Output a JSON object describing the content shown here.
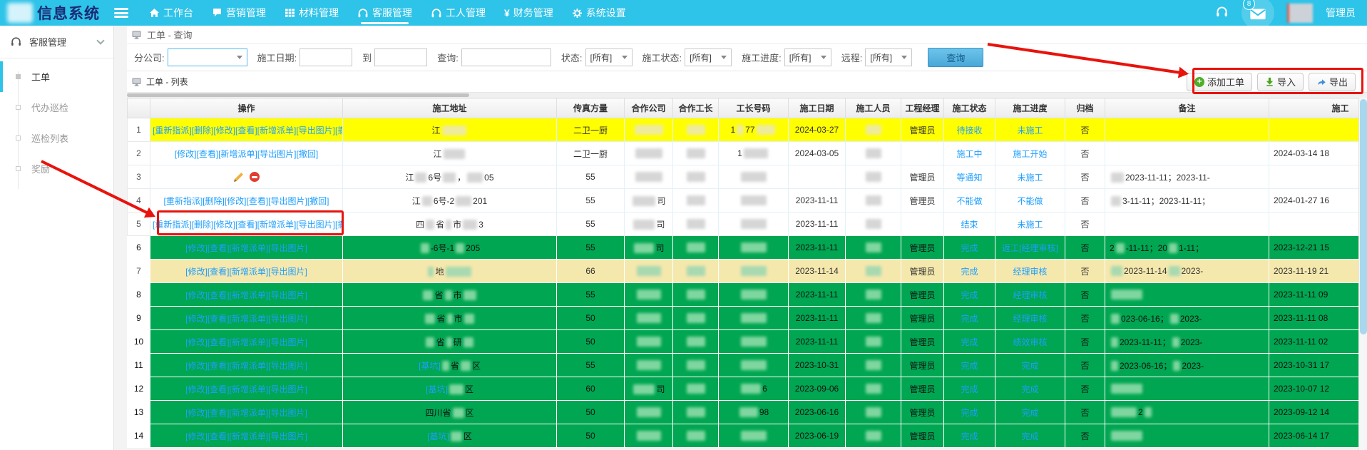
{
  "colors": {
    "accent": "#2ec3e8",
    "link": "#1e9fff",
    "row_green": "#00a651",
    "row_yellow": "#ffff00",
    "row_cream": "#f5e8ad",
    "annotation_red": "#e8130c"
  },
  "navbar": {
    "brand": "信息系统",
    "items": [
      {
        "label": "工作台",
        "icon": "home-icon",
        "active": false
      },
      {
        "label": "营销管理",
        "icon": "chat-icon",
        "active": false
      },
      {
        "label": "材料管理",
        "icon": "grid-icon",
        "active": false
      },
      {
        "label": "客服管理",
        "icon": "headset-icon",
        "active": true
      },
      {
        "label": "工人管理",
        "icon": "headset-icon",
        "active": false
      },
      {
        "label": "财务管理",
        "icon": "yen-icon",
        "active": false
      },
      {
        "label": "系统设置",
        "icon": "gear-icon",
        "active": false
      }
    ],
    "message_badge": "8",
    "username": "管理员"
  },
  "sidebar": {
    "section": "客服管理",
    "items": [
      {
        "label": "工单",
        "active": true
      },
      {
        "label": "代办巡检",
        "active": false
      },
      {
        "label": "巡检列表",
        "active": false
      },
      {
        "label": "奖励",
        "active": false
      }
    ]
  },
  "query_panel": {
    "title": "工单 - 查询",
    "branch_label": "分公司:",
    "date_label": "施工日期:",
    "to_label": "到",
    "keyword_label": "查询:",
    "status_label": "状态:",
    "work_status_label": "施工状态:",
    "progress_label": "施工进度:",
    "remote_label": "远程:",
    "all_option": "[所有]",
    "search_button": "查询"
  },
  "toolbar": {
    "add": "添加工单",
    "import": "导入",
    "export": "导出"
  },
  "list_panel": {
    "title": "工单 - 列表"
  },
  "table": {
    "headers": [
      "",
      "操作",
      "施工地址",
      "传真方量",
      "合作公司",
      "合作工长",
      "工长号码",
      "施工日期",
      "施工人员",
      "工程经理",
      "施工状态",
      "施工进度",
      "归档",
      "备注",
      "施工"
    ],
    "rows": [
      {
        "num": "1",
        "bg": "yellow",
        "ops": {
          "type": "links",
          "text": "[重新指派][删除][修改][查看][新增派单][导出图片][撤回]"
        },
        "addr": [
          {
            "t": "江"
          },
          {
            "b": 34
          }
        ],
        "volume": "二卫一厨",
        "partner": [
          {
            "b": 40
          }
        ],
        "foreman": [
          {
            "b": 26
          }
        ],
        "phone": [
          {
            "t": "1"
          },
          {
            "b": 10
          },
          {
            "t": "77"
          },
          {
            "b": 26
          }
        ],
        "date": "2024-03-27",
        "worker": [
          {
            "b": 22
          }
        ],
        "manager": "管理员",
        "status": "待接收",
        "progress": "未施工",
        "archived": "否",
        "remark": [],
        "time": ""
      },
      {
        "num": "2",
        "bg": "white",
        "ops": {
          "type": "links",
          "text": "[修改][查看][新增派单][导出图片][撤回]"
        },
        "addr": [
          {
            "t": "江"
          },
          {
            "b": 30
          }
        ],
        "volume": "二卫一厨",
        "partner": [
          {
            "b": 38
          }
        ],
        "foreman": [
          {
            "b": 26
          }
        ],
        "phone": [
          {
            "t": "1"
          },
          {
            "b": 34
          }
        ],
        "date": "2024-03-05",
        "worker": [
          {
            "b": 22
          }
        ],
        "manager": "",
        "status": "施工中",
        "progress": "施工开始",
        "archived": "否",
        "remark": [],
        "time": "2024-03-14 18"
      },
      {
        "num": "3",
        "bg": "white",
        "ops": {
          "type": "icons"
        },
        "addr": [
          {
            "t": "江"
          },
          {
            "b": 16
          },
          {
            "t": "6号"
          },
          {
            "b": 18
          },
          {
            "t": "，"
          },
          {
            "b": 22
          },
          {
            "t": "05"
          }
        ],
        "volume": "55",
        "partner": [
          {
            "b": 38
          }
        ],
        "foreman": [
          {
            "b": 26
          }
        ],
        "phone": [
          {
            "b": 36
          }
        ],
        "date": "",
        "worker": [
          {
            "b": 22
          }
        ],
        "manager": "管理员",
        "status": "等通知",
        "progress": "未施工",
        "archived": "否",
        "remark": [
          {
            "b": 18
          },
          {
            "t": "2023-11-11；2023-11-"
          }
        ],
        "time": ""
      },
      {
        "num": "4",
        "bg": "white",
        "ops": {
          "type": "links",
          "text": "[重新指派][删除][修改][查看][导出图片][撤回]"
        },
        "addr": [
          {
            "t": "江"
          },
          {
            "b": 14
          },
          {
            "t": "6号-2"
          },
          {
            "b": 22
          },
          {
            "t": "201"
          }
        ],
        "volume": "55",
        "partner": [
          {
            "b": 32
          },
          {
            "t": "司"
          }
        ],
        "foreman": [
          {
            "b": 26
          }
        ],
        "phone": [
          {
            "b": 36
          }
        ],
        "date": "2023-11-11",
        "worker": [
          {
            "b": 22
          }
        ],
        "manager": "管理员",
        "status": "不能做",
        "progress": "不能做",
        "archived": "否",
        "remark": [
          {
            "b": 14
          },
          {
            "t": "3-11-11；2023-11-11；"
          }
        ],
        "time": "2024-01-27 16"
      },
      {
        "num": "5",
        "bg": "white",
        "boxed": true,
        "ops": {
          "type": "links",
          "text": "[重新指派][删除][修改][查看][新增派单][导出图片][撤回]"
        },
        "addr": [
          {
            "t": "四"
          },
          {
            "b": 12
          },
          {
            "t": "省"
          },
          {
            "b": 8
          },
          {
            "t": "市"
          },
          {
            "b": 20
          },
          {
            "t": "3"
          }
        ],
        "volume": "55",
        "partner": [
          {
            "b": 30
          },
          {
            "t": "司"
          }
        ],
        "foreman": [
          {
            "b": 26
          }
        ],
        "phone": [
          {
            "b": 36
          }
        ],
        "date": "2023-11-11",
        "worker": [
          {
            "b": 22
          }
        ],
        "manager": "",
        "status": "结束",
        "progress": "未施工",
        "archived": "否",
        "remark": [],
        "time": ""
      },
      {
        "num": "6",
        "bg": "green",
        "ops": {
          "type": "links",
          "text": "[修改][查看][新增派单][导出图片]"
        },
        "addr": [
          {
            "b": 12
          },
          {
            "t": "-6号-1"
          },
          {
            "b": 12
          },
          {
            "t": "205"
          }
        ],
        "volume": "55",
        "partner": [
          {
            "b": 28
          },
          {
            "t": "司"
          }
        ],
        "foreman": [
          {
            "b": 26
          }
        ],
        "phone": [
          {
            "b": 36
          }
        ],
        "date": "2023-11-11",
        "worker": [
          {
            "b": 22
          }
        ],
        "manager": "管理员",
        "status": "完成",
        "progress": "返工[经理审核]",
        "archived": "否",
        "remark": [
          {
            "t": "2"
          },
          {
            "b": 12
          },
          {
            "t": "-11-11；20"
          },
          {
            "b": 12
          },
          {
            "t": "1-11；"
          }
        ],
        "time": "2023-12-21 15"
      },
      {
        "num": "7",
        "bg": "cream",
        "ops": {
          "type": "links",
          "text": "[修改][查看][新增派单][导出图片]"
        },
        "addr": [
          {
            "b": 8
          },
          {
            "t": "地"
          },
          {
            "b": 36
          }
        ],
        "volume": "66",
        "partner": [
          {
            "b": 34
          }
        ],
        "foreman": [
          {
            "b": 26
          }
        ],
        "phone": [
          {
            "b": 36
          }
        ],
        "date": "2023-11-14",
        "worker": [
          {
            "b": 22
          }
        ],
        "manager": "管理员",
        "status": "完成",
        "progress": "经理审核",
        "archived": "否",
        "remark": [
          {
            "b": 16
          },
          {
            "t": "2023-11-14"
          },
          {
            "b": 16
          },
          {
            "t": "2023-"
          }
        ],
        "time": "2023-11-19 21"
      },
      {
        "num": "8",
        "bg": "green",
        "ops": {
          "type": "links",
          "text": "[修改][查看][新增派单][导出图片]"
        },
        "addr": [
          {
            "b": 14
          },
          {
            "t": "省"
          },
          {
            "b": 10
          },
          {
            "t": "市"
          },
          {
            "b": 18
          }
        ],
        "volume": "55",
        "partner": [
          {
            "b": 34
          }
        ],
        "foreman": [
          {
            "b": 26
          }
        ],
        "phone": [
          {
            "b": 36
          }
        ],
        "date": "2023-11-11",
        "worker": [
          {
            "b": 22
          }
        ],
        "manager": "管理员",
        "status": "完成",
        "progress": "经理审核",
        "archived": "否",
        "remark": [
          {
            "b": 44
          }
        ],
        "time": "2023-11-11 09"
      },
      {
        "num": "9",
        "bg": "green",
        "ops": {
          "type": "links",
          "text": "[修改][查看][新增派单][导出图片]"
        },
        "addr": [
          {
            "b": 14
          },
          {
            "t": "省"
          },
          {
            "b": 8
          },
          {
            "t": "市"
          },
          {
            "b": 14
          }
        ],
        "volume": "50",
        "partner": [
          {
            "b": 34
          }
        ],
        "foreman": [
          {
            "b": 26
          }
        ],
        "phone": [
          {
            "b": 36
          }
        ],
        "date": "2023-11-11",
        "worker": [
          {
            "b": 22
          }
        ],
        "manager": "管理员",
        "status": "完成",
        "progress": "经理审核",
        "archived": "否",
        "remark": [
          {
            "b": 12
          },
          {
            "t": "023-06-16；"
          },
          {
            "b": 12
          },
          {
            "t": "2023-"
          }
        ],
        "time": "2023-11-11 08"
      },
      {
        "num": "10",
        "bg": "green",
        "ops": {
          "type": "links",
          "text": "[修改][查看][新增派单][导出图片]"
        },
        "addr": [
          {
            "b": 12
          },
          {
            "t": "省"
          },
          {
            "b": 8
          },
          {
            "t": "研"
          },
          {
            "b": 14
          }
        ],
        "volume": "50",
        "partner": [
          {
            "b": 34
          }
        ],
        "foreman": [
          {
            "b": 26
          }
        ],
        "phone": [
          {
            "b": 36
          }
        ],
        "date": "2023-11-11",
        "worker": [
          {
            "b": 22
          }
        ],
        "manager": "管理员",
        "status": "完成",
        "progress": "绩效审核",
        "archived": "否",
        "remark": [
          {
            "b": 10
          },
          {
            "t": "2023-11-11；"
          },
          {
            "b": 10
          },
          {
            "t": "2023-"
          }
        ],
        "time": "2023-11-11 02"
      },
      {
        "num": "11",
        "bg": "green",
        "ops": {
          "type": "links",
          "text": "[修改][查看][新增派单][导出图片]"
        },
        "addr": [
          {
            "t": "[基坑]",
            "link": true
          },
          {
            "b": 10
          },
          {
            "t": "省"
          },
          {
            "b": 14
          },
          {
            "t": "区"
          }
        ],
        "volume": "55",
        "partner": [
          {
            "b": 34
          }
        ],
        "foreman": [
          {
            "b": 26
          }
        ],
        "phone": [
          {
            "b": 36
          }
        ],
        "date": "2023-10-31",
        "worker": [
          {
            "b": 22
          }
        ],
        "manager": "管理员",
        "status": "完成",
        "progress": "完成",
        "archived": "否",
        "remark": [
          {
            "b": 10
          },
          {
            "t": "2023-06-16；"
          },
          {
            "b": 10
          },
          {
            "t": "2023-"
          }
        ],
        "time": "2023-10-31 17"
      },
      {
        "num": "12",
        "bg": "green",
        "ops": {
          "type": "links",
          "text": "[修改][查看][新增派单][导出图片]"
        },
        "addr": [
          {
            "t": "[基坑]",
            "link": true
          },
          {
            "b": 20
          },
          {
            "t": "区"
          }
        ],
        "volume": "60",
        "partner": [
          {
            "b": 30
          },
          {
            "t": "司"
          }
        ],
        "foreman": [
          {
            "b": 26
          }
        ],
        "phone": [
          {
            "b": 28
          },
          {
            "t": "6"
          }
        ],
        "date": "2023-09-06",
        "worker": [
          {
            "b": 22
          }
        ],
        "manager": "管理员",
        "status": "完成",
        "progress": "完成",
        "archived": "否",
        "remark": [
          {
            "b": 44
          }
        ],
        "time": "2023-10-07 12"
      },
      {
        "num": "13",
        "bg": "green",
        "ops": {
          "type": "links",
          "text": "[修改][查看][新增派单][导出图片]"
        },
        "addr": [
          {
            "t": "四川省"
          },
          {
            "b": 16
          },
          {
            "t": "区"
          }
        ],
        "volume": "50",
        "partner": [
          {
            "b": 34
          }
        ],
        "foreman": [
          {
            "b": 26
          }
        ],
        "phone": [
          {
            "b": 26
          },
          {
            "t": "98"
          }
        ],
        "date": "2023-06-16",
        "worker": [
          {
            "b": 22
          }
        ],
        "manager": "管理员",
        "status": "完成",
        "progress": "完成",
        "archived": "否",
        "remark": [
          {
            "b": 36
          },
          {
            "t": "2"
          },
          {
            "b": 10
          }
        ],
        "time": "2023-09-12 14"
      },
      {
        "num": "14",
        "bg": "green",
        "ops": {
          "type": "links",
          "text": "[修改][查看][新增派单][导出图片]"
        },
        "addr": [
          {
            "t": "[基坑]",
            "link": true
          },
          {
            "b": 16
          },
          {
            "t": "区"
          }
        ],
        "volume": "50",
        "partner": [
          {
            "b": 34
          }
        ],
        "foreman": [
          {
            "b": 26
          }
        ],
        "phone": [
          {
            "b": 36
          }
        ],
        "date": "2023-06-19",
        "worker": [
          {
            "b": 22
          }
        ],
        "manager": "管理员",
        "status": "完成",
        "progress": "完成",
        "archived": "否",
        "remark": [
          {
            "b": 44
          }
        ],
        "time": "2023-06-14 17"
      }
    ]
  }
}
